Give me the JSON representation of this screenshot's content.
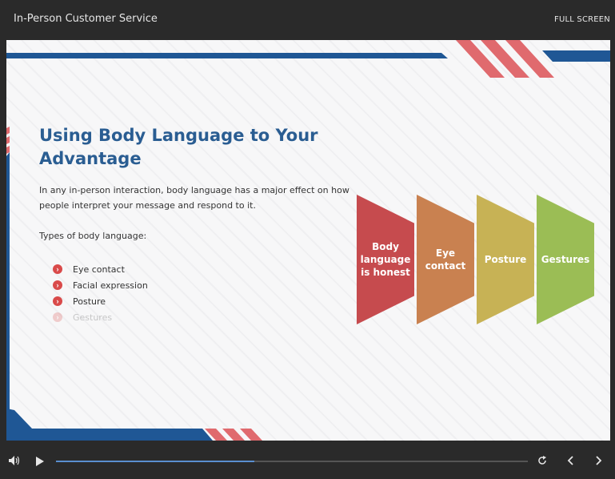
{
  "header": {
    "title": "In-Person Customer Service",
    "fullscreen_label": "FULL SCREEN"
  },
  "slide": {
    "heading_line1": "Using Body Language to Your",
    "heading_line2": "Advantage",
    "paragraph_line1": "In any in-person interaction, body language has a major effect on how",
    "paragraph_line2": "people interpret your message and respond to it.",
    "types_label": "Types of body language:",
    "bullets": [
      {
        "label": "Eye contact",
        "faded": false
      },
      {
        "label": "Facial expression",
        "faded": false
      },
      {
        "label": "Posture",
        "faded": false
      },
      {
        "label": "Gestures",
        "faded": true
      }
    ],
    "diagram": [
      {
        "lines": [
          "Body",
          "language",
          "is honest"
        ],
        "color": "#c64b4e"
      },
      {
        "lines": [
          "Eye",
          "contact"
        ],
        "color": "#c98150"
      },
      {
        "lines": [
          "Posture"
        ],
        "color": "#c7b255"
      },
      {
        "lines": [
          "Gestures"
        ],
        "color": "#9bbd55"
      }
    ]
  },
  "player": {
    "progress": 0.42,
    "icons": [
      "volume-icon",
      "play-icon",
      "replay-icon",
      "previous-icon",
      "next-icon"
    ]
  },
  "colors": {
    "accent_blue": "#2a5d92",
    "accent_red": "#d94a4a",
    "progress": "#5a8fd0"
  }
}
